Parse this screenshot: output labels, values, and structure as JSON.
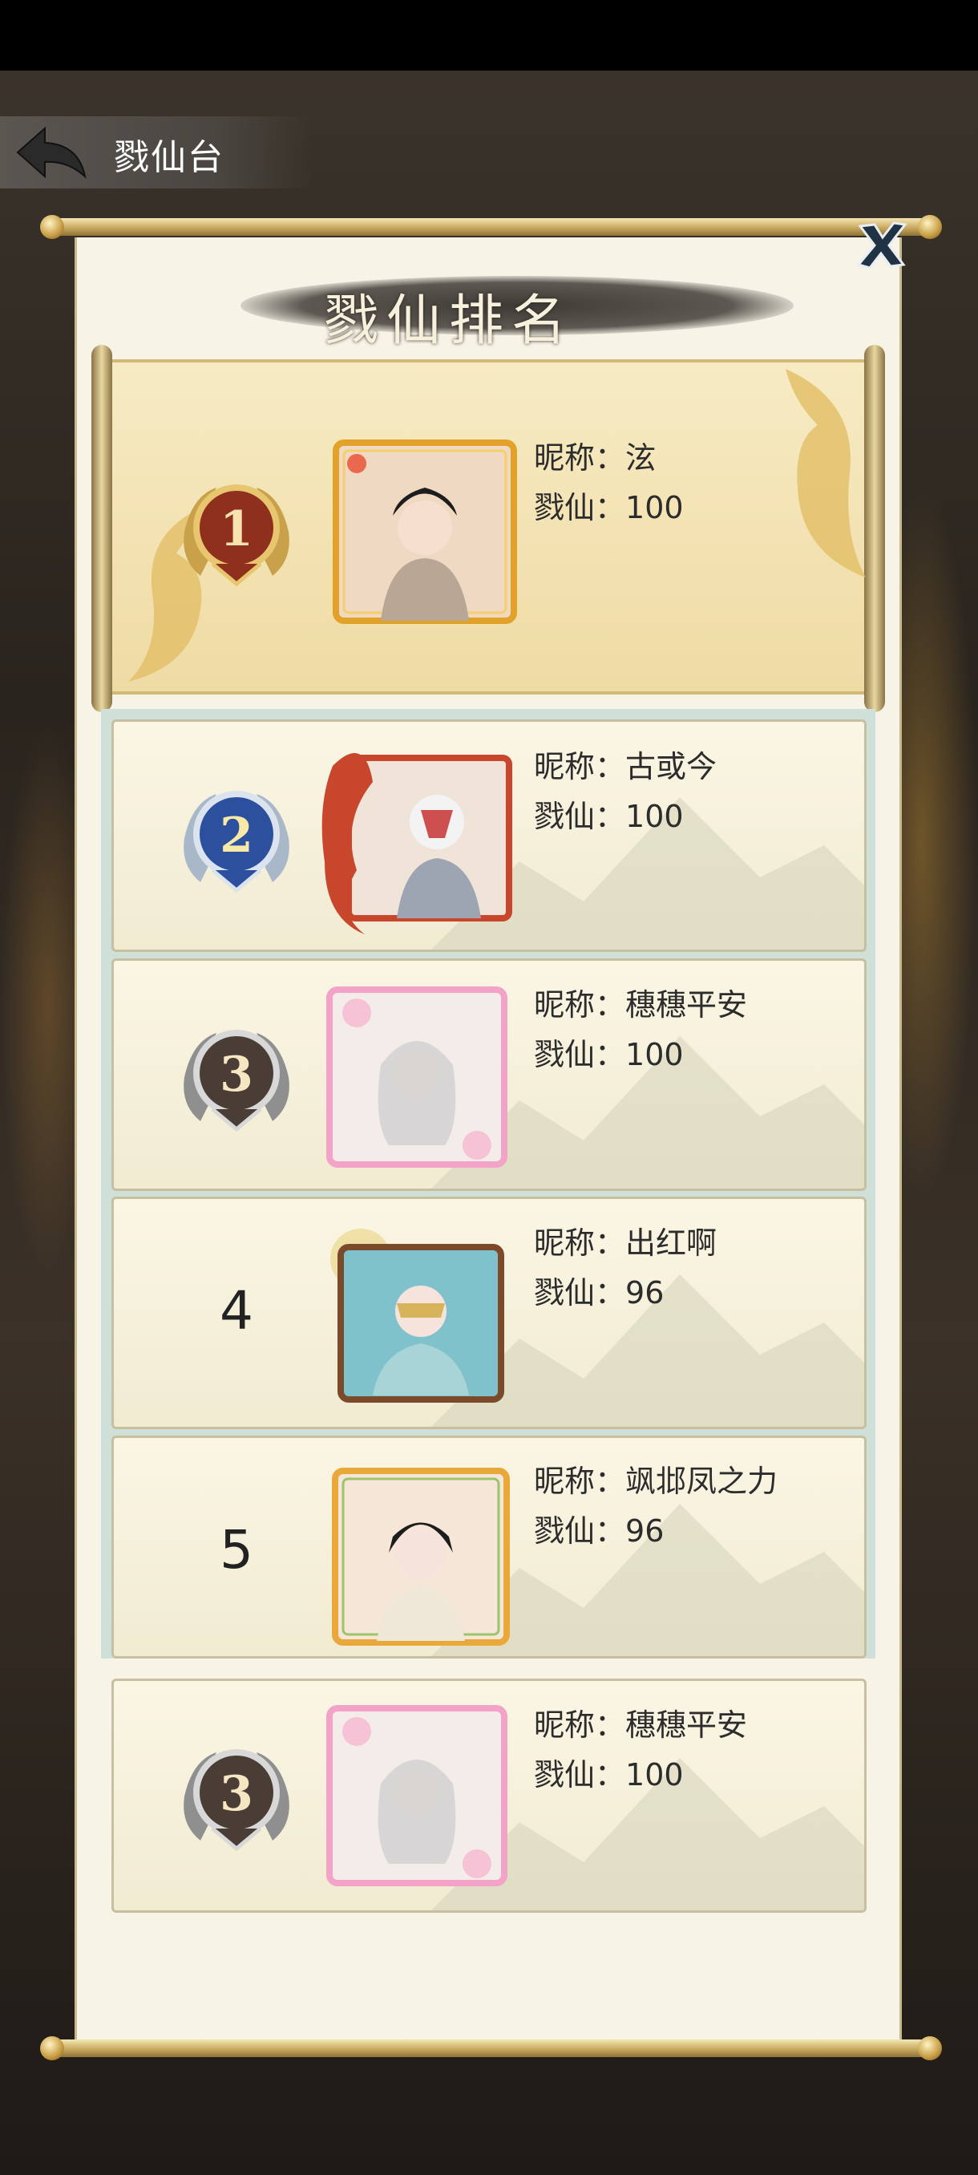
{
  "header": {
    "title": "戮仙台"
  },
  "panel": {
    "title": "戮仙排名"
  },
  "labels": {
    "nickname": "昵称：",
    "score": "戮仙："
  },
  "rankings": [
    {
      "rank": "1",
      "nickname": "泫",
      "score": "100",
      "badge": "gold"
    },
    {
      "rank": "2",
      "nickname": "古或今",
      "score": "100",
      "badge": "blue"
    },
    {
      "rank": "3",
      "nickname": "穗穗平安",
      "score": "100",
      "badge": "silver"
    },
    {
      "rank": "4",
      "nickname": "出红啊",
      "score": "96",
      "badge": "none"
    },
    {
      "rank": "5",
      "nickname": "飒邶凤之力",
      "score": "96",
      "badge": "none"
    }
  ],
  "my_rank": {
    "rank": "3",
    "nickname": "穗穗平安",
    "score": "100"
  },
  "colors": {
    "panel_bg": "#f7f3e6",
    "gold": "#c9a95e",
    "text": "#2c2c2c"
  }
}
